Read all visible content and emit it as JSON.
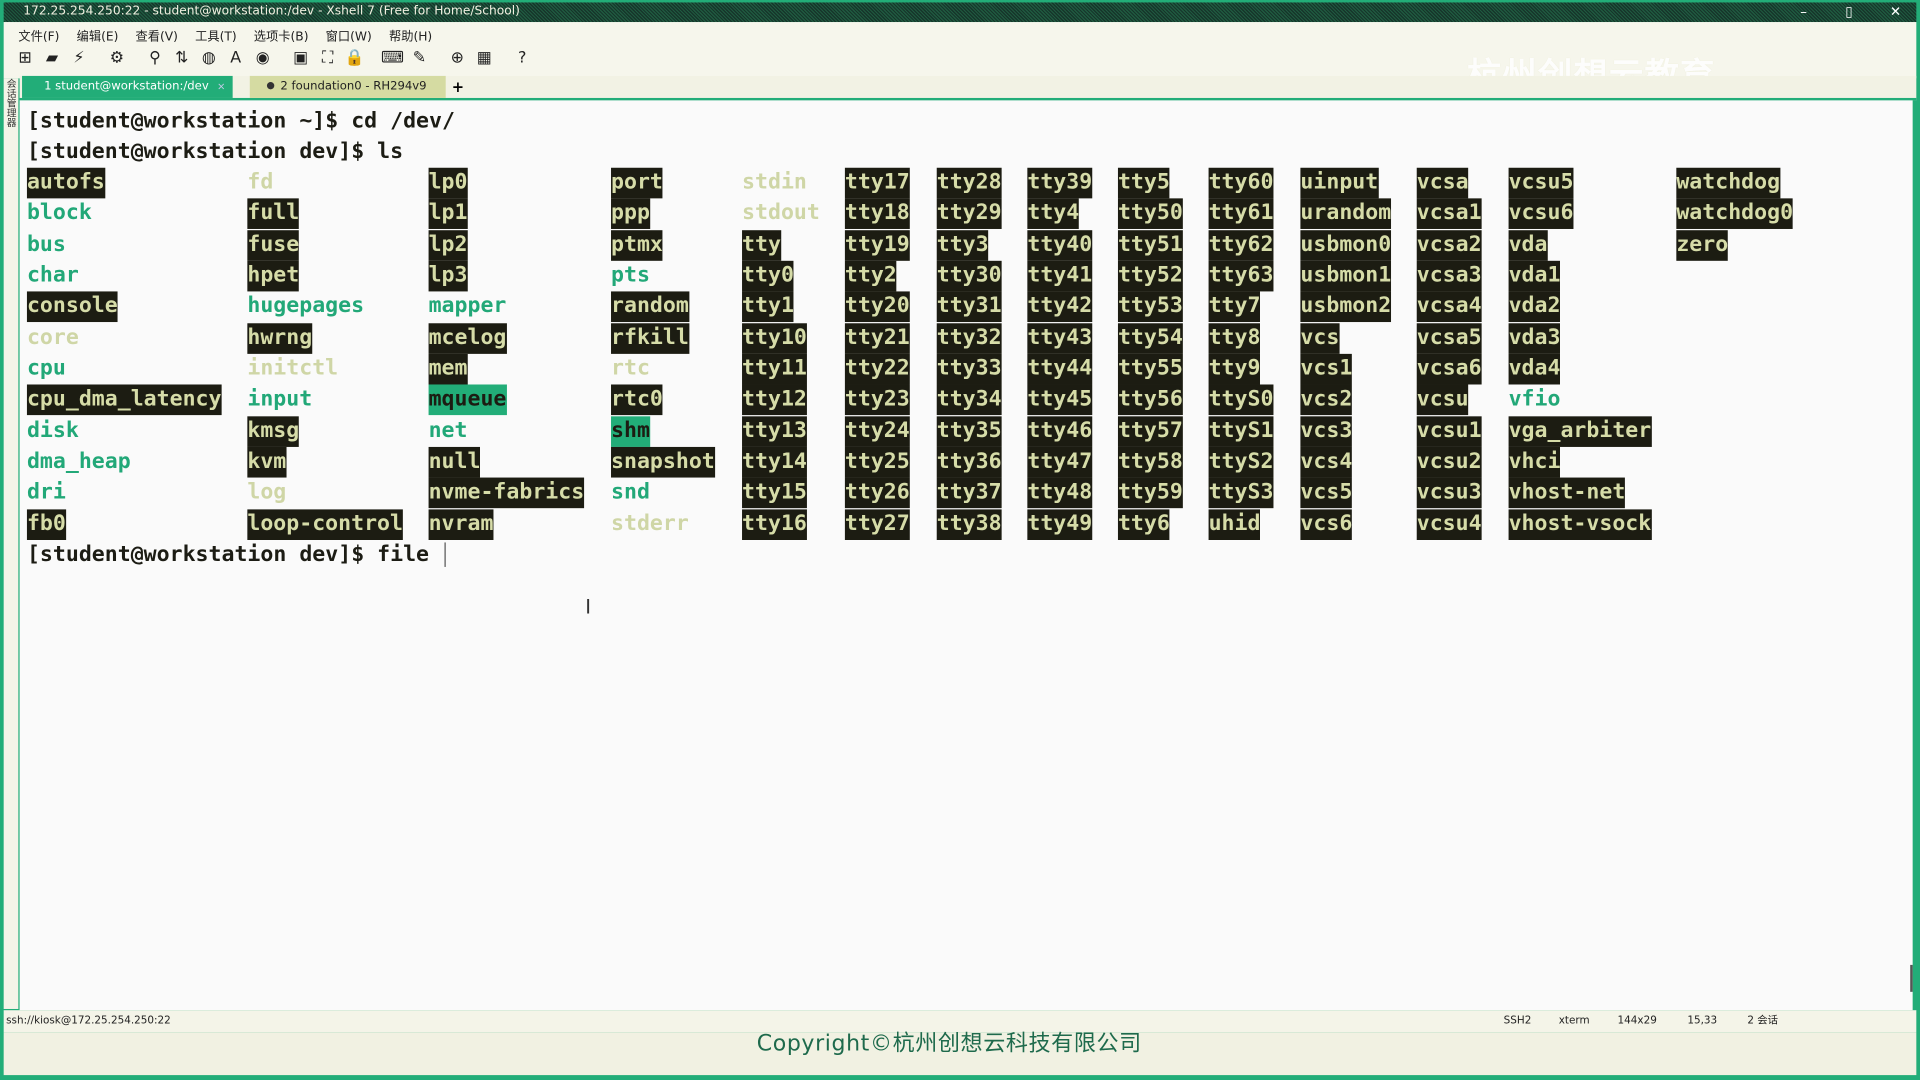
{
  "window": {
    "title": "172.25.254.250:22 - student@workstation:/dev - Xshell 7 (Free for Home/School)"
  },
  "menu": [
    "文件(F)",
    "编辑(E)",
    "查看(V)",
    "工具(T)",
    "选项卡(B)",
    "窗口(W)",
    "帮助(H)"
  ],
  "toolbar_icons": [
    {
      "name": "new-session-icon",
      "glyph": "⊞"
    },
    {
      "name": "open-folder-icon",
      "glyph": "▰"
    },
    {
      "name": "reconnect-icon",
      "glyph": "⚡"
    },
    {
      "name": "properties-icon",
      "glyph": "⚙"
    },
    {
      "name": "find-icon",
      "glyph": "⚲"
    },
    {
      "name": "transfer-icon",
      "glyph": "⇅"
    },
    {
      "name": "globe-icon",
      "glyph": "◍"
    },
    {
      "name": "font-icon",
      "glyph": "A"
    },
    {
      "name": "xftp-icon",
      "glyph": "◉"
    },
    {
      "name": "script-icon",
      "glyph": "▣"
    },
    {
      "name": "fullscreen-icon",
      "glyph": "⛶"
    },
    {
      "name": "lock-icon",
      "glyph": "🔒"
    },
    {
      "name": "keyboard-icon",
      "glyph": "⌨"
    },
    {
      "name": "highlight-icon",
      "glyph": "✎"
    },
    {
      "name": "add-tab-icon",
      "glyph": "⊕"
    },
    {
      "name": "layout-icon",
      "glyph": "▦"
    },
    {
      "name": "help-icon",
      "glyph": "?"
    }
  ],
  "watermark": "杭州创想云教育",
  "tabs": [
    {
      "label": "1 student@workstation:/dev",
      "close": "×"
    },
    {
      "label": "2 foundation0 - RH294v9"
    }
  ],
  "new_tab": "+",
  "sidebar_label": "会话管理器",
  "terminal": {
    "lines": [
      "[student@workstation ~]$ cd /dev/",
      "[student@workstation dev]$ ls"
    ],
    "prompt": "[student@workstation dev]$ file ",
    "columns": [
      [
        [
          "autofs",
          "c"
        ],
        [
          "block",
          "d"
        ],
        [
          "bus",
          "d"
        ],
        [
          "char",
          "d"
        ],
        [
          "console",
          "c"
        ],
        [
          "core",
          "l"
        ],
        [
          "cpu",
          "d"
        ],
        [
          "cpu_dma_latency",
          "c"
        ],
        [
          "disk",
          "d"
        ],
        [
          "dma_heap",
          "d"
        ],
        [
          "dri",
          "d"
        ],
        [
          "fb0",
          "c"
        ]
      ],
      [
        [
          "fd",
          "l"
        ],
        [
          "full",
          "c"
        ],
        [
          "fuse",
          "c"
        ],
        [
          "hpet",
          "c"
        ],
        [
          "hugepages",
          "d"
        ],
        [
          "hwrng",
          "c"
        ],
        [
          "initctl",
          "l"
        ],
        [
          "input",
          "d"
        ],
        [
          "kmsg",
          "c"
        ],
        [
          "kvm",
          "c"
        ],
        [
          "log",
          "l"
        ],
        [
          "loop-control",
          "c"
        ]
      ],
      [
        [
          "lp0",
          "c"
        ],
        [
          "lp1",
          "c"
        ],
        [
          "lp2",
          "c"
        ],
        [
          "lp3",
          "c"
        ],
        [
          "mapper",
          "d"
        ],
        [
          "mcelog",
          "c"
        ],
        [
          "mem",
          "c"
        ],
        [
          "mqueue",
          "s"
        ],
        [
          "net",
          "d"
        ],
        [
          "null",
          "c"
        ],
        [
          "nvme-fabrics",
          "c"
        ],
        [
          "nvram",
          "c"
        ]
      ],
      [
        [
          "port",
          "c"
        ],
        [
          "ppp",
          "c"
        ],
        [
          "ptmx",
          "c"
        ],
        [
          "pts",
          "d"
        ],
        [
          "random",
          "c"
        ],
        [
          "rfkill",
          "c"
        ],
        [
          "rtc",
          "l"
        ],
        [
          "rtc0",
          "c"
        ],
        [
          "shm",
          "s"
        ],
        [
          "snapshot",
          "c"
        ],
        [
          "snd",
          "d"
        ],
        [
          "stderr",
          "l"
        ]
      ],
      [
        [
          "stdin",
          "l"
        ],
        [
          "stdout",
          "l"
        ],
        [
          "tty",
          "c"
        ],
        [
          "tty0",
          "c"
        ],
        [
          "tty1",
          "c"
        ],
        [
          "tty10",
          "c"
        ],
        [
          "tty11",
          "c"
        ],
        [
          "tty12",
          "c"
        ],
        [
          "tty13",
          "c"
        ],
        [
          "tty14",
          "c"
        ],
        [
          "tty15",
          "c"
        ],
        [
          "tty16",
          "c"
        ]
      ],
      [
        [
          "tty17",
          "c"
        ],
        [
          "tty18",
          "c"
        ],
        [
          "tty19",
          "c"
        ],
        [
          "tty2",
          "c"
        ],
        [
          "tty20",
          "c"
        ],
        [
          "tty21",
          "c"
        ],
        [
          "tty22",
          "c"
        ],
        [
          "tty23",
          "c"
        ],
        [
          "tty24",
          "c"
        ],
        [
          "tty25",
          "c"
        ],
        [
          "tty26",
          "c"
        ],
        [
          "tty27",
          "c"
        ]
      ],
      [
        [
          "tty28",
          "c"
        ],
        [
          "tty29",
          "c"
        ],
        [
          "tty3",
          "c"
        ],
        [
          "tty30",
          "c"
        ],
        [
          "tty31",
          "c"
        ],
        [
          "tty32",
          "c"
        ],
        [
          "tty33",
          "c"
        ],
        [
          "tty34",
          "c"
        ],
        [
          "tty35",
          "c"
        ],
        [
          "tty36",
          "c"
        ],
        [
          "tty37",
          "c"
        ],
        [
          "tty38",
          "c"
        ]
      ],
      [
        [
          "tty39",
          "c"
        ],
        [
          "tty4",
          "c"
        ],
        [
          "tty40",
          "c"
        ],
        [
          "tty41",
          "c"
        ],
        [
          "tty42",
          "c"
        ],
        [
          "tty43",
          "c"
        ],
        [
          "tty44",
          "c"
        ],
        [
          "tty45",
          "c"
        ],
        [
          "tty46",
          "c"
        ],
        [
          "tty47",
          "c"
        ],
        [
          "tty48",
          "c"
        ],
        [
          "tty49",
          "c"
        ]
      ],
      [
        [
          "tty5",
          "c"
        ],
        [
          "tty50",
          "c"
        ],
        [
          "tty51",
          "c"
        ],
        [
          "tty52",
          "c"
        ],
        [
          "tty53",
          "c"
        ],
        [
          "tty54",
          "c"
        ],
        [
          "tty55",
          "c"
        ],
        [
          "tty56",
          "c"
        ],
        [
          "tty57",
          "c"
        ],
        [
          "tty58",
          "c"
        ],
        [
          "tty59",
          "c"
        ],
        [
          "tty6",
          "c"
        ]
      ],
      [
        [
          "tty60",
          "c"
        ],
        [
          "tty61",
          "c"
        ],
        [
          "tty62",
          "c"
        ],
        [
          "tty63",
          "c"
        ],
        [
          "tty7",
          "c"
        ],
        [
          "tty8",
          "c"
        ],
        [
          "tty9",
          "c"
        ],
        [
          "ttyS0",
          "c"
        ],
        [
          "ttyS1",
          "c"
        ],
        [
          "ttyS2",
          "c"
        ],
        [
          "ttyS3",
          "c"
        ],
        [
          "uhid",
          "c"
        ]
      ],
      [
        [
          "uinput",
          "c"
        ],
        [
          "urandom",
          "c"
        ],
        [
          "usbmon0",
          "c"
        ],
        [
          "usbmon1",
          "c"
        ],
        [
          "usbmon2",
          "c"
        ],
        [
          "vcs",
          "c"
        ],
        [
          "vcs1",
          "c"
        ],
        [
          "vcs2",
          "c"
        ],
        [
          "vcs3",
          "c"
        ],
        [
          "vcs4",
          "c"
        ],
        [
          "vcs5",
          "c"
        ],
        [
          "vcs6",
          "c"
        ]
      ],
      [
        [
          "vcsa",
          "c"
        ],
        [
          "vcsa1",
          "c"
        ],
        [
          "vcsa2",
          "c"
        ],
        [
          "vcsa3",
          "c"
        ],
        [
          "vcsa4",
          "c"
        ],
        [
          "vcsa5",
          "c"
        ],
        [
          "vcsa6",
          "c"
        ],
        [
          "vcsu",
          "c"
        ],
        [
          "vcsu1",
          "c"
        ],
        [
          "vcsu2",
          "c"
        ],
        [
          "vcsu3",
          "c"
        ],
        [
          "vcsu4",
          "c"
        ]
      ],
      [
        [
          "vcsu5",
          "c"
        ],
        [
          "vcsu6",
          "c"
        ],
        [
          "vda",
          "c"
        ],
        [
          "vda1",
          "c"
        ],
        [
          "vda2",
          "c"
        ],
        [
          "vda3",
          "c"
        ],
        [
          "vda4",
          "c"
        ],
        [
          "vfio",
          "d"
        ],
        [
          "vga_arbiter",
          "c"
        ],
        [
          "vhci",
          "c"
        ],
        [
          "vhost-net",
          "c"
        ],
        [
          "vhost-vsock",
          "c"
        ]
      ],
      [
        [
          "watchdog",
          "c"
        ],
        [
          "watchdog0",
          "c"
        ],
        [
          "zero",
          "c"
        ]
      ]
    ]
  },
  "status": {
    "connection": "ssh://kiosk@172.25.254.250:22",
    "protocol": "SSH2",
    "term": "xterm",
    "size": "144x29",
    "cursor": "15,33",
    "sessions": "2 会话"
  },
  "copyright": "Copyright©杭州创想云科技有限公司",
  "colors": {
    "accent": "#22ad78",
    "device_bg": "#1c1c12",
    "device_fg": "#d6dca8",
    "dir": "#22a878",
    "link": "#cfd6a6"
  }
}
